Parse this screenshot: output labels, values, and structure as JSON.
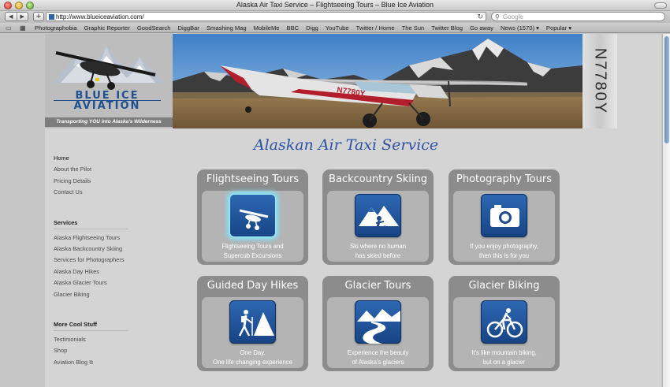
{
  "window": {
    "title": "Alaska Air Taxi Service – Flightseeing Tours – Blue Ice Aviation"
  },
  "toolbar": {
    "back_glyph": "◀",
    "forward_glyph": "▶",
    "add_glyph": "+",
    "url": "http://www.blueiceaviation.com/",
    "search_placeholder": "Google"
  },
  "bookmarks": [
    "Photographobia",
    "Graphic Reporter",
    "GoodSearch",
    "DiggBar",
    "Smashing Mag",
    "MobileMe",
    "BBC",
    "Digg",
    "YouTube",
    "Twitter / Home",
    "The Sun",
    "Twitter Blog",
    "Go away",
    "News (1570) ▾",
    "Popular ▾"
  ],
  "logo": {
    "line1": "BLUE ICE",
    "line2": "AVIATION",
    "tagline": "Transporting YOU into Alaska's Wilderness"
  },
  "hero": {
    "plane_registration": "N7780Y"
  },
  "tail_number": "N7780Y",
  "sidebar": {
    "main_links": [
      "Home",
      "About the Pilot",
      "Pricing Details",
      "Contact Us"
    ],
    "services_heading": "Services",
    "services_links": [
      "Alaska Flightseeing Tours",
      "Alaska Backcountry Skiing",
      "Services for Photographers",
      "Alaska Day Hikes",
      "Alaska Glacier Tours",
      "Glacier Biking"
    ],
    "more_heading": "More Cool Stuff",
    "more_links": [
      "Testimonials",
      "Shop",
      "Aviation Blog"
    ]
  },
  "main": {
    "heading": "Alaskan Air Taxi Service",
    "tiles": [
      {
        "title": "Flightseeing Tours",
        "desc1": "Flightseeing Tours and",
        "desc2": "Supercub Excursions",
        "icon": "plane-icon"
      },
      {
        "title": "Backcountry Skiing",
        "desc1": "Ski where no human",
        "desc2": "has skied before",
        "icon": "skier-icon"
      },
      {
        "title": "Photography Tours",
        "desc1": "If you enjoy photography,",
        "desc2": "then this is for you",
        "icon": "camera-icon"
      },
      {
        "title": "Guided Day Hikes",
        "desc1": "One Day.",
        "desc2": "One life changing experience",
        "icon": "hiker-icon"
      },
      {
        "title": "Glacier Tours",
        "desc1": "Experience the beauty",
        "desc2": "of Alaska's glaciers",
        "icon": "glacier-icon"
      },
      {
        "title": "Glacier Biking",
        "desc1": "It's like mountain biking,",
        "desc2": "but on a glacier",
        "icon": "bike-icon"
      }
    ]
  },
  "colors": {
    "brand_blue": "#1f4f8f",
    "heading_blue": "#2c52a4",
    "tile_gray": "#8c8c8c",
    "icon_blue": "#174485"
  }
}
